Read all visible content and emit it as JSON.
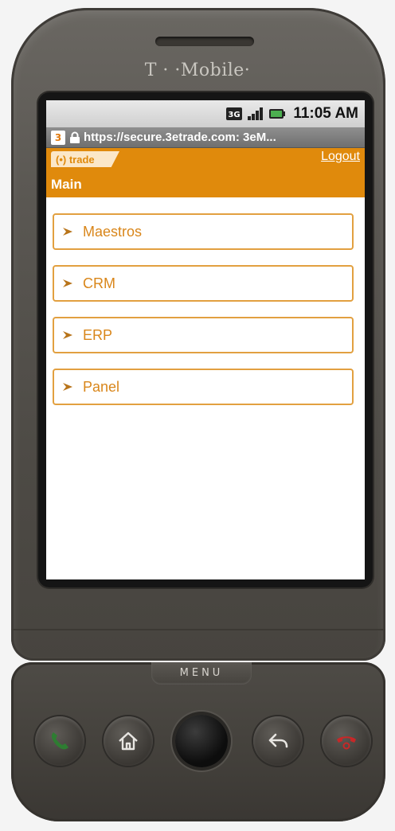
{
  "device": {
    "brand": "T · ·Mobile·",
    "menu_key_label": "MENU",
    "hardware_buttons": [
      "call-icon",
      "home-icon",
      "trackball",
      "back-icon",
      "end-call-icon"
    ]
  },
  "statusbar": {
    "icons": [
      "3g-icon",
      "signal-icon",
      "battery-icon"
    ],
    "time": "11:05 AM"
  },
  "browser": {
    "url": "https://secure.3etrade.com: 3eM..."
  },
  "header": {
    "logo_text": "(•) trade",
    "logout_label": "Logout",
    "page_title": "Main",
    "accent_color": "#e08a0c"
  },
  "menu": {
    "items": [
      {
        "label": "Maestros"
      },
      {
        "label": "CRM"
      },
      {
        "label": "ERP"
      },
      {
        "label": "Panel"
      }
    ]
  }
}
